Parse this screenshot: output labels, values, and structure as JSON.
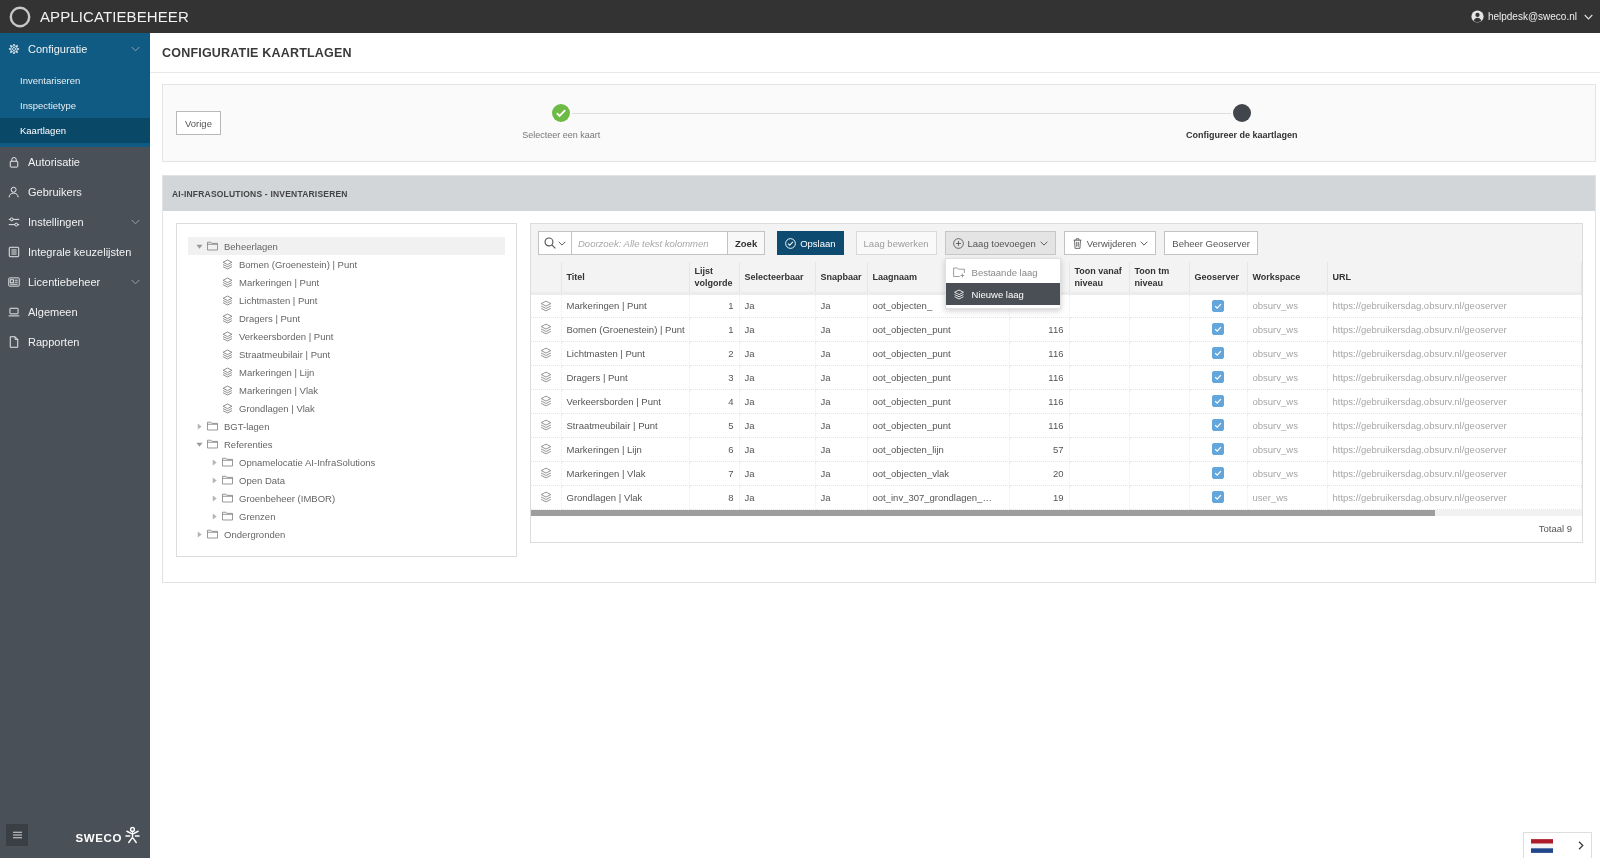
{
  "topbar": {
    "app_title": "APPLICATIEBEHEER",
    "user": "helpdesk@sweco.nl"
  },
  "sidebar": {
    "items": [
      {
        "label": "Configuratie",
        "kind": "group",
        "expanded": true,
        "children": [
          {
            "label": "Inventariseren",
            "selected": false
          },
          {
            "label": "Inspectietype",
            "selected": false
          },
          {
            "label": "Kaartlagen",
            "selected": true
          }
        ]
      },
      {
        "label": "Autorisatie",
        "kind": "link",
        "expanded": false
      },
      {
        "label": "Gebruikers",
        "kind": "link",
        "expanded": false
      },
      {
        "label": "Instellingen",
        "kind": "group",
        "expanded": false
      },
      {
        "label": "Integrale keuzelijsten",
        "kind": "link",
        "expanded": false
      },
      {
        "label": "Licentiebeheer",
        "kind": "group",
        "expanded": false
      },
      {
        "label": "Algemeen",
        "kind": "link",
        "expanded": false
      },
      {
        "label": "Rapporten",
        "kind": "link",
        "expanded": false
      }
    ],
    "footer": {
      "logo_text": "SWECO"
    }
  },
  "page": {
    "title": "CONFIGURATIE KAARTLAGEN"
  },
  "wizard": {
    "back_button": "Vorige",
    "steps": [
      {
        "label": "Selecteer een kaart",
        "completed": true,
        "current": false
      },
      {
        "label": "Configureer de kaartlagen",
        "completed": false,
        "current": true
      }
    ]
  },
  "panel": {
    "title": "AI-INFRASOLUTIONS - INVENTARISEREN"
  },
  "tree": {
    "nodes": [
      {
        "label": "Beheerlagen",
        "kind": "folder",
        "expanded": true,
        "selected": true,
        "children": [
          {
            "label": "Bomen (Groenestein) | Punt",
            "kind": "layer",
            "selected": false
          },
          {
            "label": "Markeringen | Punt",
            "kind": "layer",
            "selected": false
          },
          {
            "label": "Lichtmasten | Punt",
            "kind": "layer",
            "selected": false
          },
          {
            "label": "Dragers | Punt",
            "kind": "layer",
            "selected": false
          },
          {
            "label": "Verkeersborden | Punt",
            "kind": "layer",
            "selected": false
          },
          {
            "label": "Straatmeubilair | Punt",
            "kind": "layer",
            "selected": false
          },
          {
            "label": "Markeringen | Lijn",
            "kind": "layer",
            "selected": false
          },
          {
            "label": "Markeringen | Vlak",
            "kind": "layer",
            "selected": false
          },
          {
            "label": "Grondlagen | Vlak",
            "kind": "layer",
            "selected": false
          }
        ]
      },
      {
        "label": "BGT-lagen",
        "kind": "folder",
        "expanded": false,
        "selected": false
      },
      {
        "label": "Referenties",
        "kind": "folder",
        "expanded": true,
        "selected": false,
        "children": [
          {
            "label": "Opnamelocatie AI-InfraSolutions",
            "kind": "folder",
            "expanded": false,
            "selected": false
          },
          {
            "label": "Open Data",
            "kind": "folder",
            "expanded": false,
            "selected": false
          },
          {
            "label": "Groenbeheer (IMBOR)",
            "kind": "folder",
            "expanded": false,
            "selected": false
          },
          {
            "label": "Grenzen",
            "kind": "folder",
            "expanded": false,
            "selected": false
          }
        ]
      },
      {
        "label": "Ondergronden",
        "kind": "folder",
        "expanded": false,
        "selected": false
      }
    ]
  },
  "toolbar": {
    "search": {
      "placeholder": "Doorzoek: Alle tekst kolommen",
      "button": "Zoek"
    },
    "buttons": [
      {
        "label": "Opslaan",
        "kind": "primary",
        "disabled": false
      },
      {
        "label": "Laag bewerken",
        "kind": "plain",
        "disabled": true
      },
      {
        "label": "Laag toevoegen",
        "kind": "menu",
        "disabled": false,
        "expanded": true,
        "menu_items": [
          {
            "label": "Bestaande laag",
            "selected": false
          },
          {
            "label": "Nieuwe laag",
            "selected": true
          }
        ]
      },
      {
        "label": "Verwijderen",
        "kind": "menu",
        "disabled": false,
        "expanded": false
      },
      {
        "label": "Beheer Geoserver",
        "kind": "plain",
        "disabled": false
      }
    ]
  },
  "table": {
    "columns": [
      "Titel",
      "Lijst volgorde",
      "Selecteerbaar",
      "Snapbaar",
      "Laagnaam",
      "Toon vanaf niveau",
      "Toon tm niveau",
      "Geoserver",
      "Workspace",
      "URL"
    ],
    "rows": [
      {
        "titel": "Markeringen | Punt",
        "lijst_volgorde": "1",
        "selecteerbaar": "Ja",
        "snapbaar": "Ja",
        "laagnaam": "oot_objecten_",
        "geoserver_checked": true,
        "workspace": "obsurv_ws",
        "url": "https://gebruikersdag.obsurv.nl/geoserver"
      },
      {
        "titel": "Bomen (Groenestein) | Punt",
        "lijst_volgorde": "1",
        "selecteerbaar": "Ja",
        "snapbaar": "Ja",
        "laagnaam": "oot_objecten_punt",
        "column_6": "116",
        "geoserver_checked": true,
        "workspace": "obsurv_ws",
        "url": "https://gebruikersdag.obsurv.nl/geoserver"
      },
      {
        "titel": "Lichtmasten | Punt",
        "lijst_volgorde": "2",
        "selecteerbaar": "Ja",
        "snapbaar": "Ja",
        "laagnaam": "oot_objecten_punt",
        "column_6": "116",
        "geoserver_checked": true,
        "workspace": "obsurv_ws",
        "url": "https://gebruikersdag.obsurv.nl/geoserver"
      },
      {
        "titel": "Dragers | Punt",
        "lijst_volgorde": "3",
        "selecteerbaar": "Ja",
        "snapbaar": "Ja",
        "laagnaam": "oot_objecten_punt",
        "column_6": "116",
        "geoserver_checked": true,
        "workspace": "obsurv_ws",
        "url": "https://gebruikersdag.obsurv.nl/geoserver"
      },
      {
        "titel": "Verkeersborden | Punt",
        "lijst_volgorde": "4",
        "selecteerbaar": "Ja",
        "snapbaar": "Ja",
        "laagnaam": "oot_objecten_punt",
        "column_6": "116",
        "geoserver_checked": true,
        "workspace": "obsurv_ws",
        "url": "https://gebruikersdag.obsurv.nl/geoserver"
      },
      {
        "titel": "Straatmeubilair | Punt",
        "lijst_volgorde": "5",
        "selecteerbaar": "Ja",
        "snapbaar": "Ja",
        "laagnaam": "oot_objecten_punt",
        "column_6": "116",
        "geoserver_checked": true,
        "workspace": "obsurv_ws",
        "url": "https://gebruikersdag.obsurv.nl/geoserver"
      },
      {
        "titel": "Markeringen | Lijn",
        "lijst_volgorde": "6",
        "selecteerbaar": "Ja",
        "snapbaar": "Ja",
        "laagnaam": "oot_objecten_lijn",
        "column_6": "57",
        "geoserver_checked": true,
        "workspace": "obsurv_ws",
        "url": "https://gebruikersdag.obsurv.nl/geoserver"
      },
      {
        "titel": "Markeringen | Vlak",
        "lijst_volgorde": "7",
        "selecteerbaar": "Ja",
        "snapbaar": "Ja",
        "laagnaam": "oot_objecten_vlak",
        "column_6": "20",
        "geoserver_checked": true,
        "workspace": "obsurv_ws",
        "url": "https://gebruikersdag.obsurv.nl/geoserver"
      },
      {
        "titel": "Grondlagen | Vlak",
        "lijst_volgorde": "8",
        "selecteerbaar": "Ja",
        "snapbaar": "Ja",
        "laagnaam": "oot_inv_307_grondlagen_…",
        "column_6": "19",
        "geoserver_checked": true,
        "workspace": "user_ws",
        "url": "https://gebruikersdag.obsurv.nl/geoserver"
      }
    ],
    "footer": "Totaal 9"
  }
}
